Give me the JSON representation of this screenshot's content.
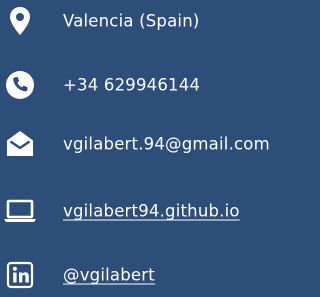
{
  "contact": {
    "location": {
      "icon": "map-marker-icon",
      "text": "Valencia (Spain)"
    },
    "phone": {
      "icon": "phone-icon",
      "text": "+34 629946144"
    },
    "email": {
      "icon": "envelope-open-icon",
      "text": "vgilabert.94@gmail.com"
    },
    "website": {
      "icon": "laptop-icon",
      "text": "vgilabert94.github.io"
    },
    "linkedin": {
      "icon": "linkedin-icon",
      "text": "@vgilabert"
    }
  },
  "colors": {
    "background": "#2d4e78",
    "foreground": "#ffffff"
  }
}
